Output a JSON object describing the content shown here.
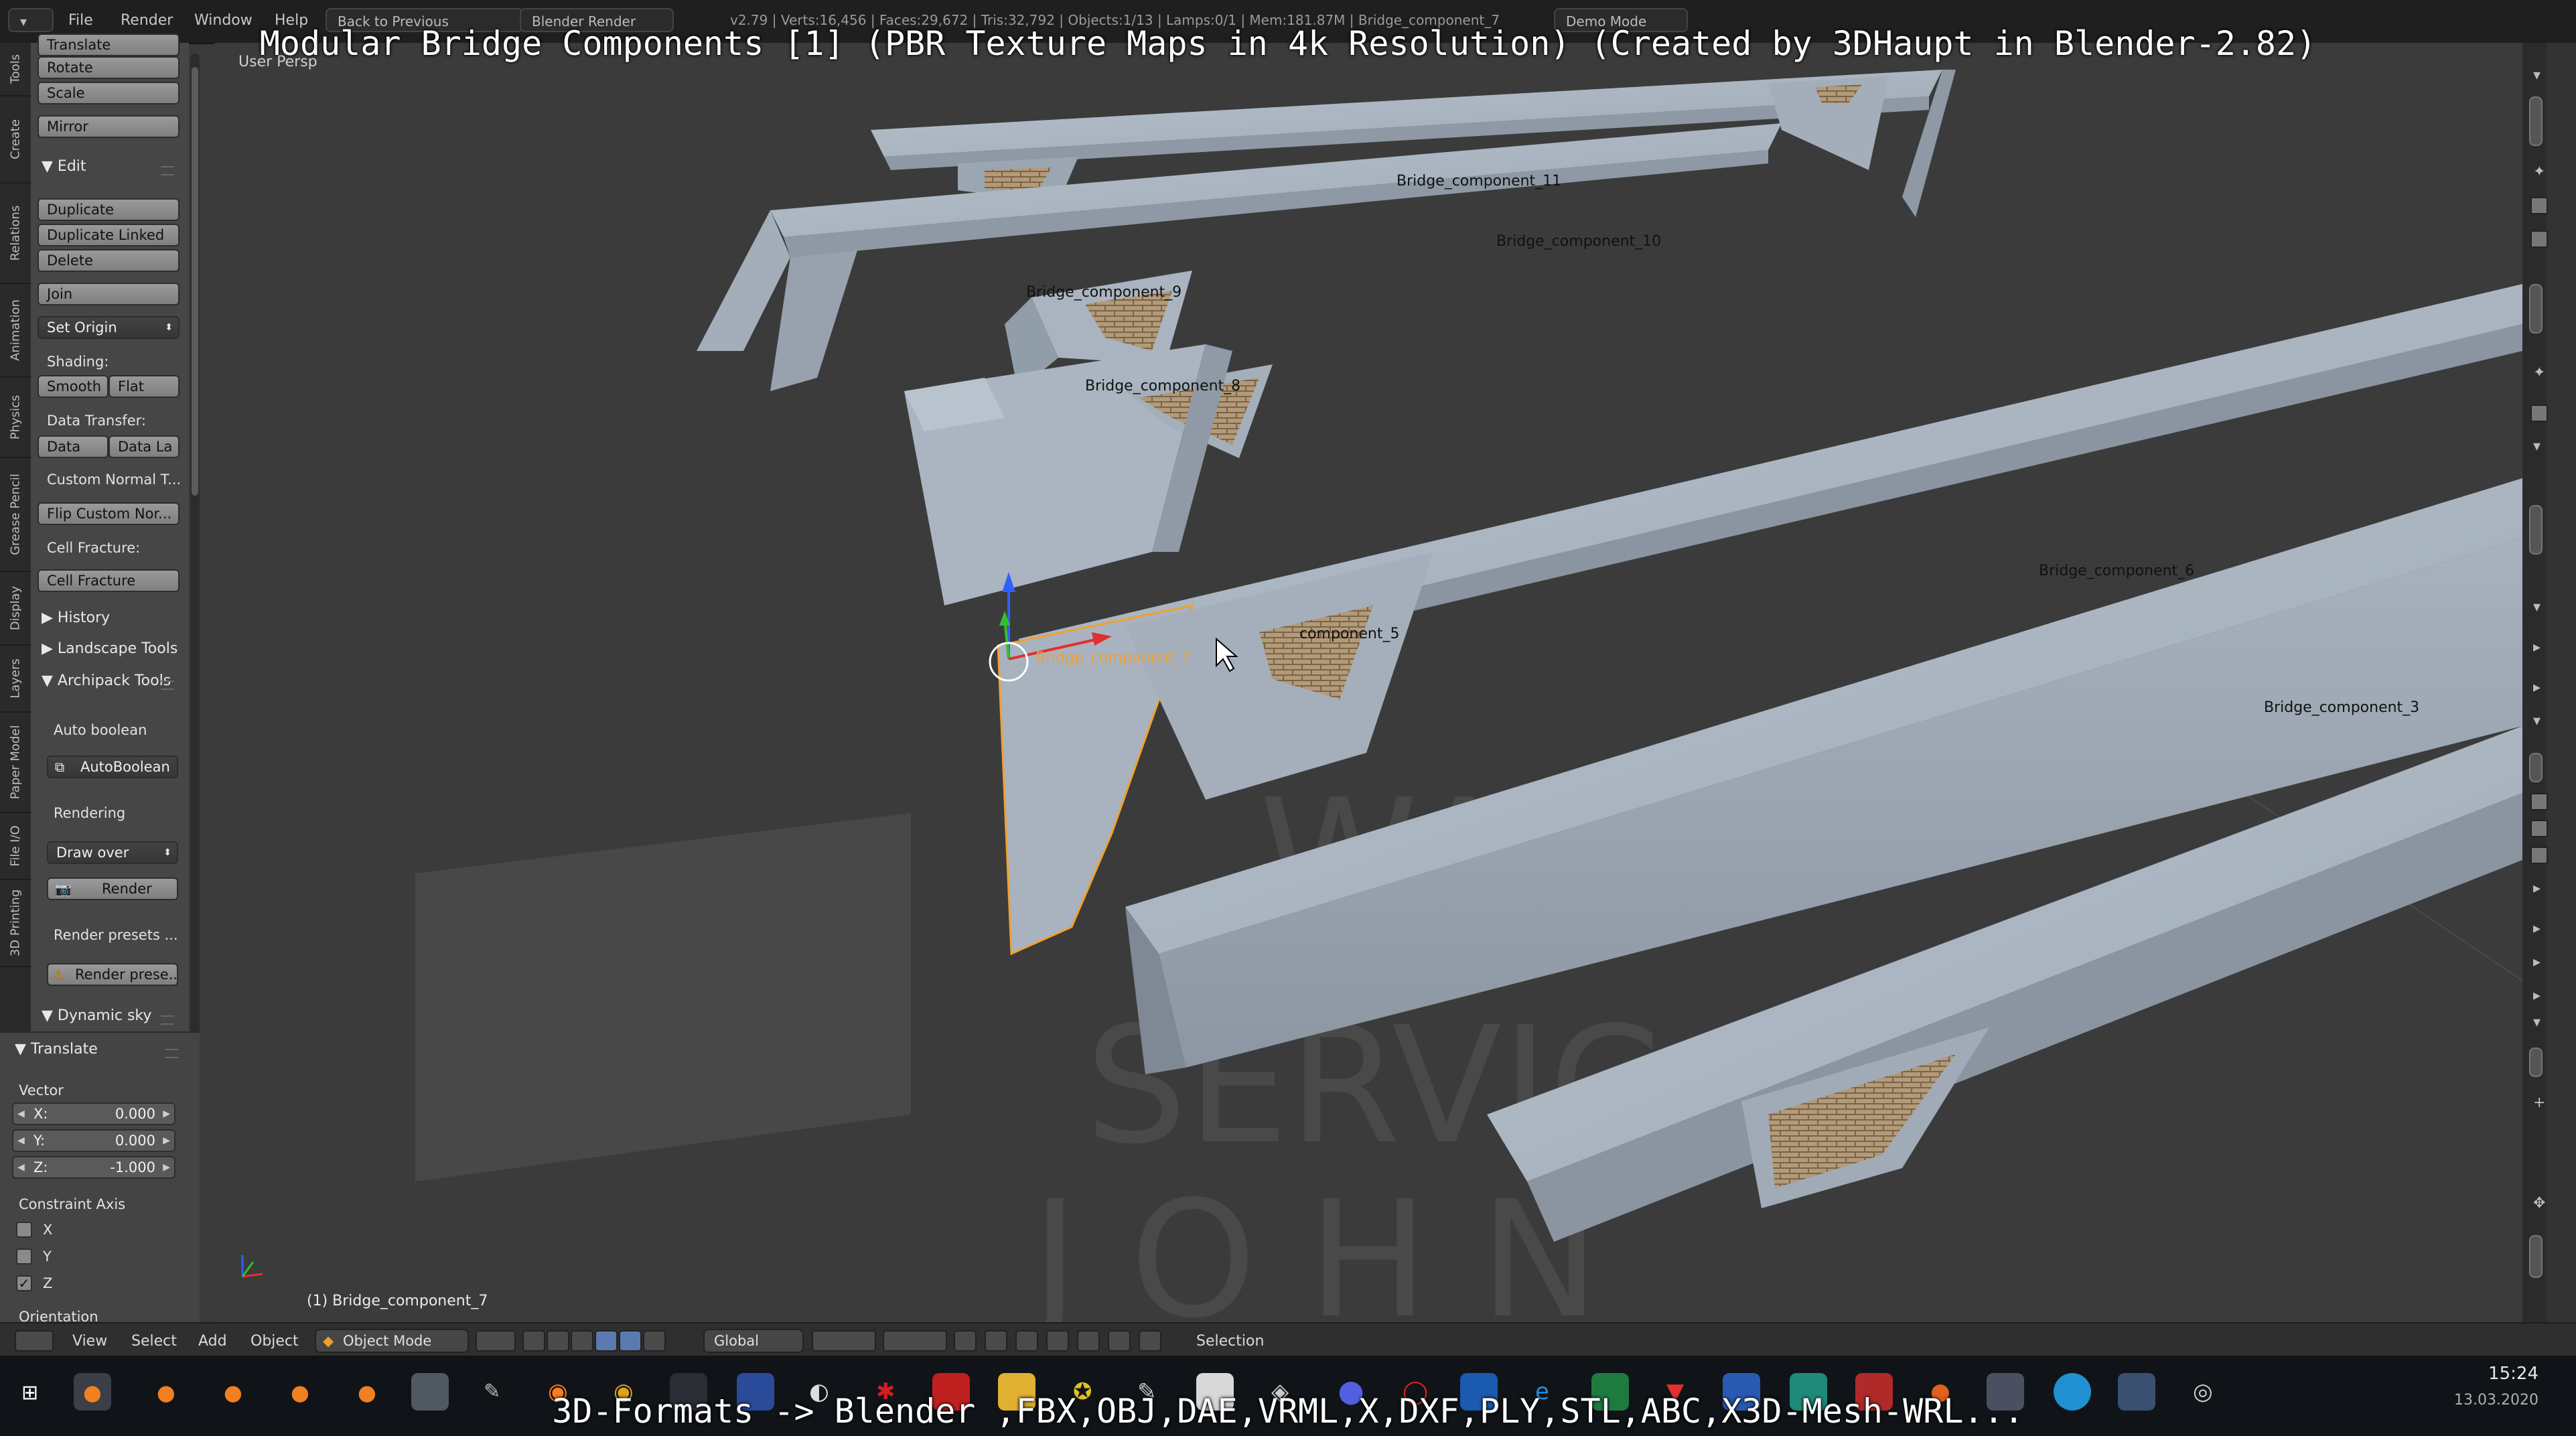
{
  "caption": {
    "top": "Modular Bridge Components [1] (PBR Texture Maps in 4k Resolution) (Created by 3DHaupt in Blender-2.82)",
    "bottom": "3D-Formats -> Blender ,FBX,OBJ,DAE,VRML,X,DXF,PLY,STL,ABC,X3D-Mesh-WRL..."
  },
  "topbar": {
    "menus": [
      "File",
      "Render",
      "Window",
      "Help"
    ],
    "back_label": "Back to Previous",
    "engine": "Blender Render",
    "stats": "v2.79 | Verts:16,456 | Faces:29,672 | Tris:32,792 | Objects:1/13 | Lamps:0/1 | Mem:181.87M | Bridge_component_7",
    "mode_label": "Demo Mode"
  },
  "tabs": [
    "Tools",
    "Create",
    "Relations",
    "Animation",
    "Physics",
    "Grease Pencil",
    "Display",
    "Layers",
    "Paper Model",
    "File I/O",
    "3D Printing"
  ],
  "toolshelf": {
    "transform_buttons": [
      "Translate",
      "Rotate",
      "Scale",
      "Mirror"
    ],
    "edit_header": "Edit",
    "edit_buttons": [
      "Duplicate",
      "Duplicate Linked",
      "Delete",
      "Join"
    ],
    "set_origin": "Set Origin",
    "shading_label": "Shading:",
    "smooth": "Smooth",
    "flat": "Flat",
    "data_transfer_label": "Data Transfer:",
    "data": "Data",
    "data_la": "Data La",
    "custom_normal": "Custom Normal T...",
    "flip_custom": "Flip Custom Nor...",
    "cell_fracture_label": "Cell Fracture:",
    "cell_fracture_button": "Cell Fracture",
    "history": "History",
    "landscape_tools": "Landscape Tools",
    "archipack_tools": "Archipack Tools",
    "auto_boolean_label": "Auto boolean",
    "auto_boolean_button": "AutoBoolean",
    "rendering_label": "Rendering",
    "draw_over": "Draw over",
    "render_button": "Render",
    "render_presets_label": "Render presets ...",
    "render_presets_button": "Render prese...",
    "dynamic_sky": "Dynamic sky"
  },
  "operator": {
    "title": "Translate",
    "vector_label": "Vector",
    "x_label": "X:",
    "x_value": "0.000",
    "y_label": "Y:",
    "y_value": "0.000",
    "z_label": "Z:",
    "z_value": "-1.000",
    "constraint_label": "Constraint Axis",
    "axes": [
      "X",
      "Y",
      "Z"
    ],
    "axes_checked": [
      false,
      false,
      true
    ],
    "orientation_label": "Orientation"
  },
  "viewport": {
    "view_label": "User Persp",
    "selected_object": "(1) Bridge_component_7",
    "object_labels": [
      "Bridge_component_11",
      "Bridge_component_10",
      "Bridge_component_9",
      "Bridge_component_8",
      "Bridge_component_7",
      "component_5",
      "Bridge_component_6",
      "Bridge_component_3"
    ],
    "watermark": [
      "WARE",
      "SERVIC",
      "J O H N"
    ]
  },
  "viewheader": {
    "menus": [
      "View",
      "Select",
      "Add",
      "Object"
    ],
    "mode": "Object Mode",
    "orientation": "Global",
    "status": "Selection"
  },
  "taskbar": {
    "time": "15:24",
    "date": "13.03.2020"
  },
  "colors": {
    "accent_orange": "#f0a030",
    "viewport_bg": "#3b3b3b",
    "panel_bg": "#464646",
    "concrete": "#a4b0bd"
  }
}
